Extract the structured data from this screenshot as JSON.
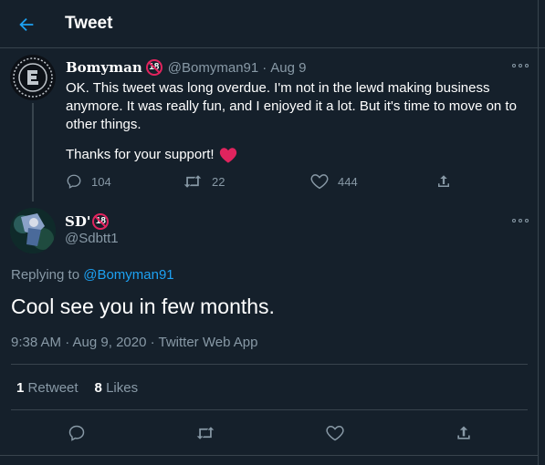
{
  "header": {
    "title": "Tweet",
    "back_icon": "arrow-left-icon"
  },
  "parent_tweet": {
    "display_name": "Bomyman",
    "badge": "18",
    "handle": "@Bomyman91",
    "date": "Aug 9",
    "separator": "·",
    "text": "OK. This tweet was long overdue. I'm not in the lewd making business anymore. It was really fun, and I enjoyed it a lot. But it's time to move on to other things.",
    "thanks": "Thanks for your support!",
    "reply_count": "104",
    "retweet_count": "22",
    "like_count": "444"
  },
  "main_tweet": {
    "display_name": "SD'",
    "badge": "18",
    "handle": "@Sdbtt1",
    "replying_prefix": "Replying to",
    "replying_to": "@Bomyman91",
    "text": "Cool see you in few months.",
    "timestamp": "9:38 AM · Aug 9, 2020 · Twitter Web App",
    "retweets_count": "1",
    "retweets_label": "Retweet",
    "likes_count": "8",
    "likes_label": "Likes"
  },
  "colors": {
    "background": "#15202b",
    "accent": "#1da1f2",
    "muted": "#8899a6",
    "border": "#38444d",
    "heart": "#e0245e"
  }
}
